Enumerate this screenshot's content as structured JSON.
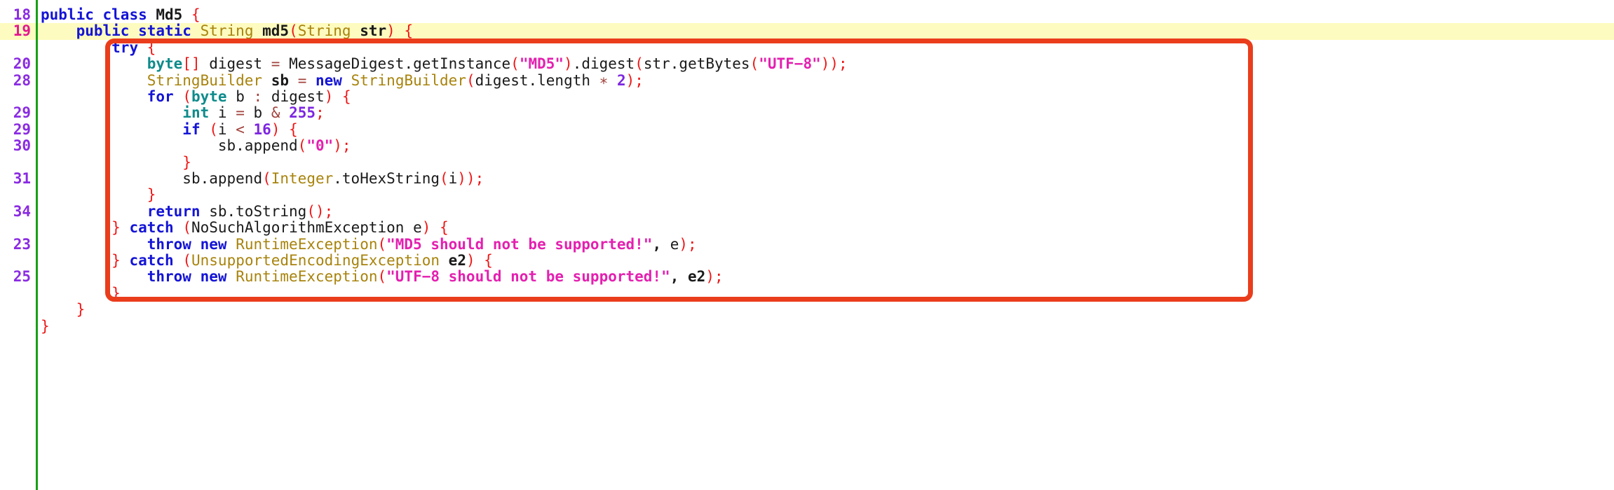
{
  "editor": {
    "language": "java",
    "class_name": "Md5",
    "method_name": "md5",
    "current_line": 19,
    "colors": {
      "background": "#ffffff",
      "current_line_highlight": "#fdfbbf",
      "gutter_rule": "#17a017",
      "annotation_box": "#ea3d1c",
      "lineno": "#8a2be2",
      "lineno_current": "#e3178f",
      "keyword": "#1414d6",
      "primitive_type": "#0f8b8b",
      "class_name": "#a8830c",
      "string": "#e420b0",
      "punctuation": "#ef1616",
      "number": "#7d26e0",
      "operator": "#a1423c",
      "identifier": "#1a1a1a"
    },
    "annotation": {
      "shape": "rounded-rectangle",
      "covers_lines": "try block through closing brace of catch"
    },
    "lines": [
      {
        "number": "18",
        "current": false,
        "tokens": [
          {
            "t": "public",
            "c": "kw"
          },
          {
            "t": " ",
            "c": "id"
          },
          {
            "t": "class",
            "c": "kw"
          },
          {
            "t": " ",
            "c": "id"
          },
          {
            "t": "Md5",
            "c": "idb"
          },
          {
            "t": " ",
            "c": "id"
          },
          {
            "t": "{",
            "c": "pun"
          }
        ]
      },
      {
        "number": "19",
        "current": true,
        "tokens": [
          {
            "t": "    ",
            "c": "id"
          },
          {
            "t": "public",
            "c": "kw"
          },
          {
            "t": " ",
            "c": "id"
          },
          {
            "t": "static",
            "c": "kw"
          },
          {
            "t": " ",
            "c": "id"
          },
          {
            "t": "String",
            "c": "cls"
          },
          {
            "t": " ",
            "c": "id"
          },
          {
            "t": "md5",
            "c": "idb"
          },
          {
            "t": "(",
            "c": "pun"
          },
          {
            "t": "String",
            "c": "cls"
          },
          {
            "t": " ",
            "c": "id"
          },
          {
            "t": "str",
            "c": "idb"
          },
          {
            "t": ")",
            "c": "pun"
          },
          {
            "t": " ",
            "c": "id"
          },
          {
            "t": "{",
            "c": "pun"
          }
        ]
      },
      {
        "number": "",
        "current": false,
        "tokens": [
          {
            "t": "        ",
            "c": "id"
          },
          {
            "t": "try",
            "c": "kw"
          },
          {
            "t": " ",
            "c": "id"
          },
          {
            "t": "{",
            "c": "pun"
          }
        ]
      },
      {
        "number": "20",
        "current": false,
        "tokens": [
          {
            "t": "            ",
            "c": "id"
          },
          {
            "t": "byte",
            "c": "typ"
          },
          {
            "t": "[]",
            "c": "pun"
          },
          {
            "t": " ",
            "c": "id"
          },
          {
            "t": "digest",
            "c": "id"
          },
          {
            "t": " ",
            "c": "id"
          },
          {
            "t": "=",
            "c": "op"
          },
          {
            "t": " ",
            "c": "id"
          },
          {
            "t": "MessageDigest.getInstance",
            "c": "id"
          },
          {
            "t": "(",
            "c": "pun"
          },
          {
            "t": "\"MD5\"",
            "c": "str"
          },
          {
            "t": ")",
            "c": "pun"
          },
          {
            "t": ".digest",
            "c": "id"
          },
          {
            "t": "(",
            "c": "pun"
          },
          {
            "t": "str.getBytes",
            "c": "id"
          },
          {
            "t": "(",
            "c": "pun"
          },
          {
            "t": "\"UTF−8\"",
            "c": "str"
          },
          {
            "t": "))",
            "c": "pun"
          },
          {
            "t": ";",
            "c": "pun"
          }
        ]
      },
      {
        "number": "28",
        "current": false,
        "tokens": [
          {
            "t": "            ",
            "c": "id"
          },
          {
            "t": "StringBuilder",
            "c": "cls"
          },
          {
            "t": " ",
            "c": "id"
          },
          {
            "t": "sb",
            "c": "idb"
          },
          {
            "t": " ",
            "c": "id"
          },
          {
            "t": "=",
            "c": "op"
          },
          {
            "t": " ",
            "c": "id"
          },
          {
            "t": "new",
            "c": "kw"
          },
          {
            "t": " ",
            "c": "id"
          },
          {
            "t": "StringBuilder",
            "c": "cls"
          },
          {
            "t": "(",
            "c": "pun"
          },
          {
            "t": "digest.length",
            "c": "id"
          },
          {
            "t": " ",
            "c": "id"
          },
          {
            "t": "∗",
            "c": "op"
          },
          {
            "t": " ",
            "c": "id"
          },
          {
            "t": "2",
            "c": "num"
          },
          {
            "t": ")",
            "c": "pun"
          },
          {
            "t": ";",
            "c": "pun"
          }
        ]
      },
      {
        "number": "",
        "current": false,
        "tokens": [
          {
            "t": "            ",
            "c": "id"
          },
          {
            "t": "for",
            "c": "kw"
          },
          {
            "t": " ",
            "c": "id"
          },
          {
            "t": "(",
            "c": "pun"
          },
          {
            "t": "byte",
            "c": "typ"
          },
          {
            "t": " ",
            "c": "id"
          },
          {
            "t": "b",
            "c": "id"
          },
          {
            "t": " ",
            "c": "id"
          },
          {
            "t": ":",
            "c": "op"
          },
          {
            "t": " ",
            "c": "id"
          },
          {
            "t": "digest",
            "c": "id"
          },
          {
            "t": ")",
            "c": "pun"
          },
          {
            "t": " ",
            "c": "id"
          },
          {
            "t": "{",
            "c": "pun"
          }
        ]
      },
      {
        "number": "29",
        "current": false,
        "tokens": [
          {
            "t": "                ",
            "c": "id"
          },
          {
            "t": "int",
            "c": "typ"
          },
          {
            "t": " ",
            "c": "id"
          },
          {
            "t": "i",
            "c": "id"
          },
          {
            "t": " ",
            "c": "id"
          },
          {
            "t": "=",
            "c": "op"
          },
          {
            "t": " ",
            "c": "id"
          },
          {
            "t": "b",
            "c": "id"
          },
          {
            "t": " ",
            "c": "id"
          },
          {
            "t": "&",
            "c": "op"
          },
          {
            "t": " ",
            "c": "id"
          },
          {
            "t": "255",
            "c": "num"
          },
          {
            "t": ";",
            "c": "pun"
          }
        ]
      },
      {
        "number": "29",
        "current": false,
        "tokens": [
          {
            "t": "                ",
            "c": "id"
          },
          {
            "t": "if",
            "c": "kw"
          },
          {
            "t": " ",
            "c": "id"
          },
          {
            "t": "(",
            "c": "pun"
          },
          {
            "t": "i",
            "c": "id"
          },
          {
            "t": " ",
            "c": "id"
          },
          {
            "t": "<",
            "c": "op"
          },
          {
            "t": " ",
            "c": "id"
          },
          {
            "t": "16",
            "c": "num"
          },
          {
            "t": ")",
            "c": "pun"
          },
          {
            "t": " ",
            "c": "id"
          },
          {
            "t": "{",
            "c": "pun"
          }
        ]
      },
      {
        "number": "30",
        "current": false,
        "tokens": [
          {
            "t": "                    ",
            "c": "id"
          },
          {
            "t": "sb.append",
            "c": "id"
          },
          {
            "t": "(",
            "c": "pun"
          },
          {
            "t": "\"0\"",
            "c": "str"
          },
          {
            "t": ")",
            "c": "pun"
          },
          {
            "t": ";",
            "c": "pun"
          }
        ]
      },
      {
        "number": "",
        "current": false,
        "tokens": [
          {
            "t": "                ",
            "c": "id"
          },
          {
            "t": "}",
            "c": "pun"
          }
        ]
      },
      {
        "number": "31",
        "current": false,
        "tokens": [
          {
            "t": "                ",
            "c": "id"
          },
          {
            "t": "sb.append",
            "c": "id"
          },
          {
            "t": "(",
            "c": "pun"
          },
          {
            "t": "Integer",
            "c": "cls"
          },
          {
            "t": ".toHexString",
            "c": "id"
          },
          {
            "t": "(",
            "c": "pun"
          },
          {
            "t": "i",
            "c": "id"
          },
          {
            "t": "))",
            "c": "pun"
          },
          {
            "t": ";",
            "c": "pun"
          }
        ]
      },
      {
        "number": "",
        "current": false,
        "tokens": [
          {
            "t": "            ",
            "c": "id"
          },
          {
            "t": "}",
            "c": "pun"
          }
        ]
      },
      {
        "number": "34",
        "current": false,
        "tokens": [
          {
            "t": "            ",
            "c": "id"
          },
          {
            "t": "return",
            "c": "kw"
          },
          {
            "t": " ",
            "c": "id"
          },
          {
            "t": "sb.toString",
            "c": "id"
          },
          {
            "t": "()",
            "c": "pun"
          },
          {
            "t": ";",
            "c": "pun"
          }
        ]
      },
      {
        "number": "",
        "current": false,
        "tokens": [
          {
            "t": "        ",
            "c": "id"
          },
          {
            "t": "}",
            "c": "pun"
          },
          {
            "t": " ",
            "c": "id"
          },
          {
            "t": "catch",
            "c": "kw"
          },
          {
            "t": " ",
            "c": "id"
          },
          {
            "t": "(",
            "c": "pun"
          },
          {
            "t": "NoSuchAlgorithmException",
            "c": "id"
          },
          {
            "t": " ",
            "c": "id"
          },
          {
            "t": "e",
            "c": "id"
          },
          {
            "t": ")",
            "c": "pun"
          },
          {
            "t": " ",
            "c": "id"
          },
          {
            "t": "{",
            "c": "pun"
          }
        ]
      },
      {
        "number": "23",
        "current": false,
        "tokens": [
          {
            "t": "            ",
            "c": "id"
          },
          {
            "t": "throw",
            "c": "kw"
          },
          {
            "t": " ",
            "c": "id"
          },
          {
            "t": "new",
            "c": "kw"
          },
          {
            "t": " ",
            "c": "id"
          },
          {
            "t": "RuntimeException",
            "c": "cls"
          },
          {
            "t": "(",
            "c": "pun"
          },
          {
            "t": "\"MD5 should not be supported!\"",
            "c": "str"
          },
          {
            "t": ", ",
            "c": "idb"
          },
          {
            "t": "e",
            "c": "id"
          },
          {
            "t": ")",
            "c": "pun"
          },
          {
            "t": ";",
            "c": "pun"
          }
        ]
      },
      {
        "number": "",
        "current": false,
        "tokens": [
          {
            "t": "        ",
            "c": "id"
          },
          {
            "t": "}",
            "c": "pun"
          },
          {
            "t": " ",
            "c": "id"
          },
          {
            "t": "catch",
            "c": "kw"
          },
          {
            "t": " ",
            "c": "id"
          },
          {
            "t": "(",
            "c": "pun"
          },
          {
            "t": "UnsupportedEncodingException",
            "c": "cls"
          },
          {
            "t": " ",
            "c": "id"
          },
          {
            "t": "e2",
            "c": "idb"
          },
          {
            "t": ")",
            "c": "pun"
          },
          {
            "t": " ",
            "c": "id"
          },
          {
            "t": "{",
            "c": "pun"
          }
        ]
      },
      {
        "number": "25",
        "current": false,
        "tokens": [
          {
            "t": "            ",
            "c": "id"
          },
          {
            "t": "throw",
            "c": "kw"
          },
          {
            "t": " ",
            "c": "id"
          },
          {
            "t": "new",
            "c": "kw"
          },
          {
            "t": " ",
            "c": "id"
          },
          {
            "t": "RuntimeException",
            "c": "cls"
          },
          {
            "t": "(",
            "c": "pun"
          },
          {
            "t": "\"UTF−8 should not be supported!\"",
            "c": "str"
          },
          {
            "t": ", ",
            "c": "idb"
          },
          {
            "t": "e2",
            "c": "idb"
          },
          {
            "t": ")",
            "c": "pun"
          },
          {
            "t": ";",
            "c": "pun"
          }
        ]
      },
      {
        "number": "",
        "current": false,
        "tokens": [
          {
            "t": "        ",
            "c": "id"
          },
          {
            "t": "}",
            "c": "pun"
          }
        ]
      },
      {
        "number": "",
        "current": false,
        "tokens": [
          {
            "t": "    ",
            "c": "id"
          },
          {
            "t": "}",
            "c": "pun"
          }
        ]
      },
      {
        "number": "",
        "current": false,
        "tokens": [
          {
            "t": "}",
            "c": "pun"
          }
        ]
      }
    ]
  }
}
